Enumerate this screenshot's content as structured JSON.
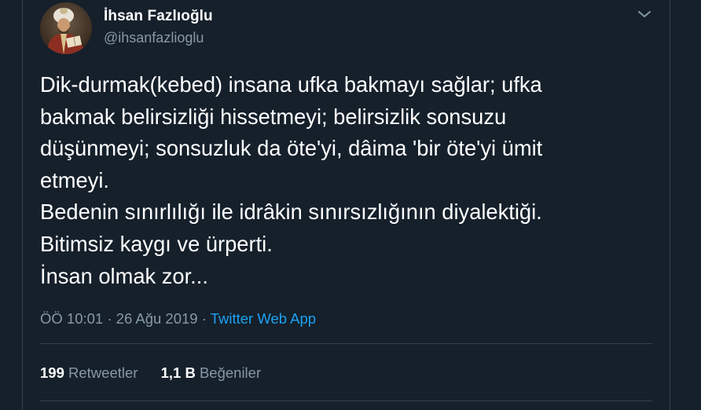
{
  "author": {
    "name": "İhsan Fazlıoğlu",
    "handle": "@ihsanfazlioglu"
  },
  "tweet": {
    "text": "Dik-durmak(kebed) insana ufka bakmayı sağlar; ufka\nbakmak belirsizliği hissetmeyi; belirsizlik sonsuzu\ndüşünmeyi; sonsuzluk da öte'yi, dâima 'bir öte'yi ümit\netmeyi.\nBedenin sınırlılığı ile idrâkin sınırsızlığının diyalektiği.\nBitimsiz kaygı ve ürperti.\nİnsan olmak zor..."
  },
  "meta": {
    "time": "ÖÖ 10:01",
    "separator1": "·",
    "date": "26 Ağu 2019",
    "separator2": "·",
    "source": "Twitter Web App"
  },
  "stats": {
    "retweets_count": "199",
    "retweets_label": "Retweetler",
    "likes_count": "1,1 B",
    "likes_label": "Beğeniler"
  },
  "icons": {
    "menu": "chevron-down-icon"
  },
  "colors": {
    "background": "#15202b",
    "border": "#38444d",
    "secondary_text": "#8899a6",
    "link": "#1da1f2"
  }
}
